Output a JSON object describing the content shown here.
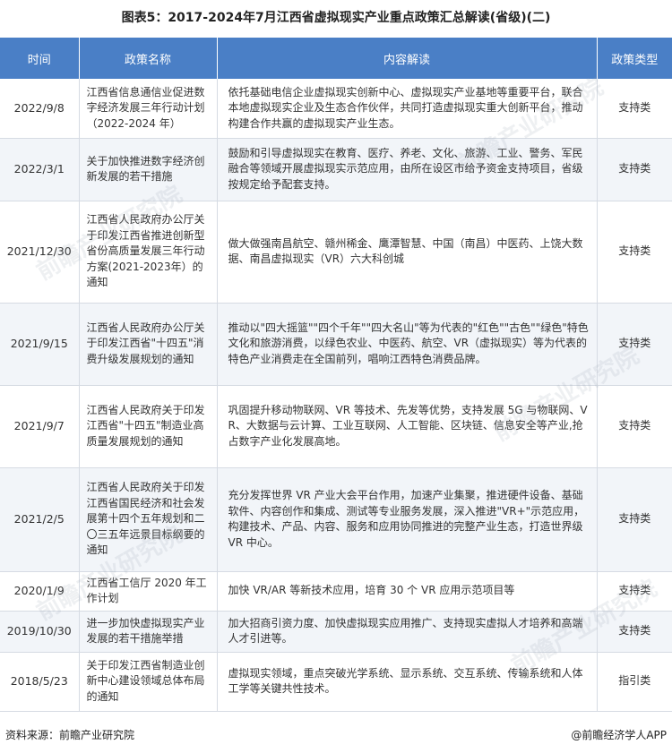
{
  "title": "图表5：2017-2024年7月江西省虚拟现实产业重点政策汇总解读(省级)(二)",
  "table": {
    "headers": [
      "时间",
      "政策名称",
      "内容解读",
      "政策类型"
    ],
    "rows": [
      {
        "date": "2022/9/8",
        "name": "江西省信息通信业促进数字经济发展三年行动计划（2022-2024 年）",
        "desc": "依托基础电信企业虚拟现实创新中心、虚拟现实产业基地等重要平台，联合本地虚拟现实企业及生态合作伙伴，共同打造虚拟现实重大创新平台，推动构建合作共赢的虚拟现实产业生态。",
        "type": "支持类"
      },
      {
        "date": "2022/3/1",
        "name": "关于加快推进数字经济创新发展的若干措施",
        "desc": "鼓励和引导虚拟现实在教育、医疗、养老、文化、旅游、工业、警务、军民融合等领域开展虚拟现实示范应用，由所在设区市给予资金支持项目，省级按规定给予配套支持。",
        "type": "支持类"
      },
      {
        "date": "2021/12/30",
        "name": "江西省人民政府办公厅关于印发江西省推进创新型省份高质量发展三年行动方案(2021-2023年）的通知",
        "desc": "做大做强南昌航空、赣州稀金、鹰潭智慧、中国（南昌）中医药、上饶大数据、南昌虚拟现实（VR）六大科创城",
        "type": "支持类"
      },
      {
        "date": "2021/9/15",
        "name": "江西省人民政府办公厅关于印发江西省\"十四五\"消费升级发展规划的通知",
        "desc": "推动以\"四大摇篮\"\"四个千年\"\"四大名山\"等为代表的\"红色\"\"古色\"\"绿色\"特色文化和旅游消费，以绿色农业、中医药、航空、VR（虚拟现实）等为代表的特色产业消费走在全国前列，唱响江西特色消费品牌。",
        "type": "支持类"
      },
      {
        "date": "2021/9/7",
        "name": "江西省人民政府关于印发江西省\"十四五\"制造业高质量发展规划的通知",
        "desc": "巩固提升移动物联网、VR 等技术、先发等优势，支持发展 5G 与物联网、VR、大数据与云计算、工业互联网、人工智能、区块链、信息安全等产业,抢占数字产业化发展高地。",
        "type": "支持类"
      },
      {
        "date": "2021/2/5",
        "name": "江西省人民政府关于印发江西省国民经济和社会发展第十四个五年规划和二〇三五年远景目标纲要的通知",
        "desc": "充分发挥世界 VR 产业大会平台作用，加速产业集聚，推进硬件设备、基础软件、内容创作和集成、测试等专业服务发展，深入推进\"VR+\"示范应用，构建技术、产品、内容、服务和应用协同推进的完整产业生态，打造世界级 VR 中心。",
        "type": "支持类"
      },
      {
        "date": "2020/1/9",
        "name": "江西省工信厅 2020 年工作计划",
        "desc": "加快 VR/AR 等新技术应用，培育 30 个 VR 应用示范项目等",
        "type": "支持类"
      },
      {
        "date": "2019/10/30",
        "name": "进一步加快虚拟现实产业发展的若干措施举措",
        "desc": "加大招商引资力度、加快虚拟现实应用推广、支持现实虚拟人才培养和高端人才引进等。",
        "type": "支持类"
      },
      {
        "date": "2018/5/23",
        "name": "关于印发江西省制造业创新中心建设领域总体布局的通知",
        "desc": "虚拟现实领域，重点突破光学系统、显示系统、交互系统、传输系统和人体工学等关键共性技术。",
        "type": "指引类"
      }
    ]
  },
  "footer": {
    "source": "资料来源：前瞻产业研究院",
    "credit": "@前瞻经济学人APP"
  },
  "watermark": "前瞻产业研究院",
  "colors": {
    "header_bg": "#4a7fc6",
    "stripe": "#f2f5f9"
  }
}
